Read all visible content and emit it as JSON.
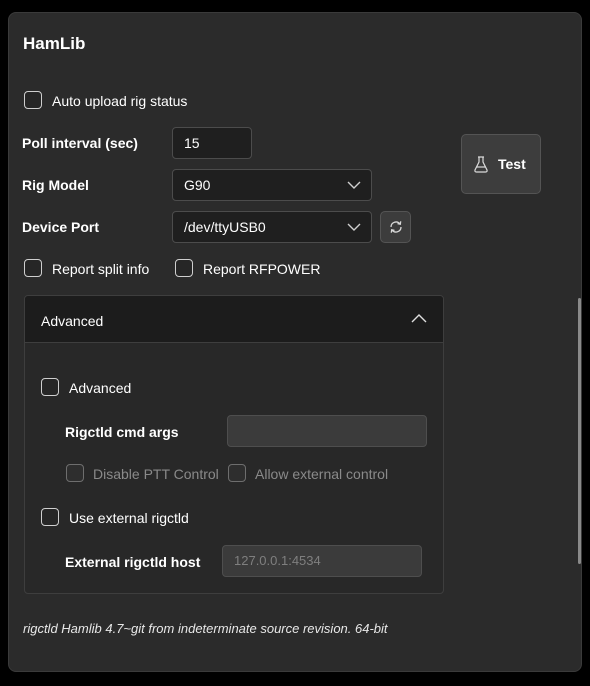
{
  "title": "HamLib",
  "auto_upload": {
    "label": "Auto upload rig status",
    "checked": false
  },
  "poll_interval": {
    "label": "Poll interval (sec)",
    "value": "15"
  },
  "rig_model": {
    "label": "Rig Model",
    "selected": "G90"
  },
  "device_port": {
    "label": "Device Port",
    "selected": "/dev/ttyUSB0"
  },
  "test_button": {
    "label": "Test",
    "icon": "flask-icon"
  },
  "refresh_button": {
    "icon": "refresh-icon"
  },
  "report_split": {
    "label": "Report split info",
    "checked": false
  },
  "report_rfpower": {
    "label": "Report RFPOWER",
    "checked": false
  },
  "advanced_section": {
    "header": "Advanced",
    "expanded": true,
    "advanced_checkbox": {
      "label": "Advanced",
      "checked": false
    },
    "cmd_args": {
      "label": "Rigctld cmd args",
      "value": ""
    },
    "disable_ptt": {
      "label": "Disable PTT Control",
      "checked": false,
      "enabled": false
    },
    "allow_external": {
      "label": "Allow external control",
      "checked": false,
      "enabled": false
    },
    "use_external": {
      "label": "Use external rigctld",
      "checked": false
    },
    "external_host": {
      "label": "External rigctld host",
      "value": "127.0.0.1:4534",
      "enabled": false
    }
  },
  "footer": "rigctld Hamlib 4.7~git from indeterminate source revision. 64-bit",
  "colors": {
    "background": "#000000",
    "card": "#2b2b2b",
    "input": "#1f1f1f",
    "text": "#ffffff",
    "disabled_text": "#8a8a8a"
  }
}
